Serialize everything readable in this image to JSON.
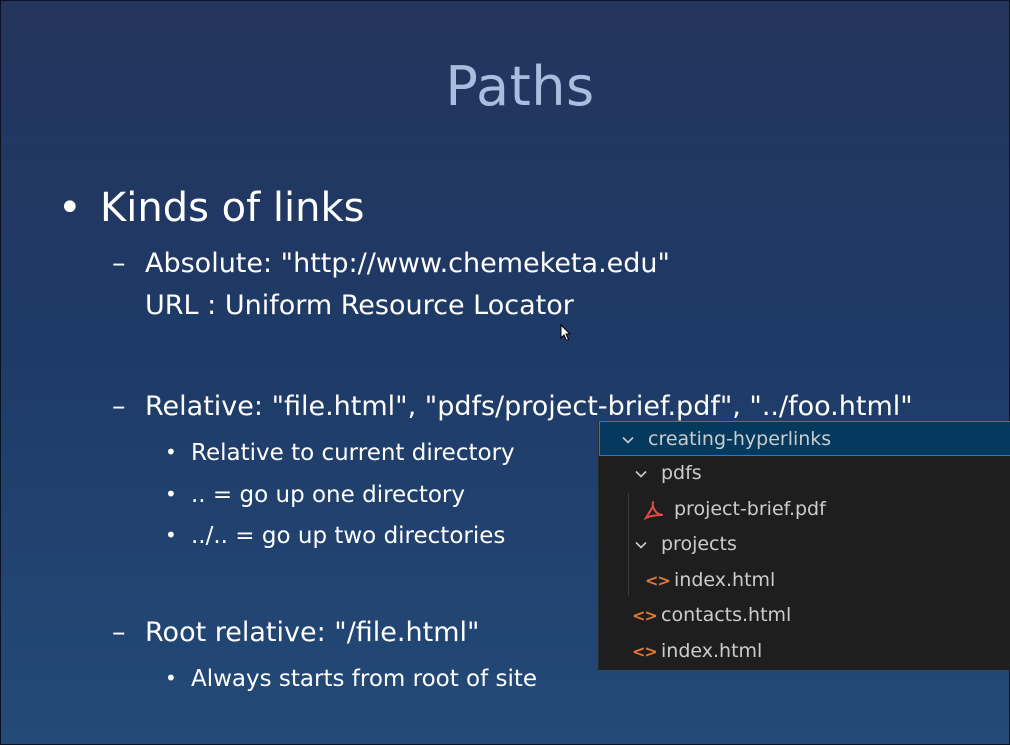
{
  "slide": {
    "title": "Paths",
    "main_bullet": "Kinds of links",
    "absolute": {
      "line1": "Absolute: \"http://www.chemeketa.edu\"",
      "line2": "URL : Uniform Resource Locator"
    },
    "relative": {
      "line": "Relative: \"file.html\", \"pdfs/project-brief.pdf\", \"../foo.html\"",
      "sub": [
        "Relative to current directory",
        ".. = go up one directory",
        "../.. = go up two directories"
      ]
    },
    "root_relative": {
      "line": "Root relative: \"/file.html\"",
      "sub": [
        "Always starts from root of site"
      ]
    },
    "bullet_glyph": "•",
    "dash_glyph": "–"
  },
  "explorer": {
    "root": "creating-hyperlinks",
    "items": [
      {
        "label": "pdfs",
        "type": "folder",
        "icon": "chevron-down-icon"
      },
      {
        "label": "project-brief.pdf",
        "type": "file",
        "icon": "pdf-icon"
      },
      {
        "label": "projects",
        "type": "folder",
        "icon": "chevron-down-icon"
      },
      {
        "label": "index.html",
        "type": "file",
        "icon": "html-code-icon"
      },
      {
        "label": "contacts.html",
        "type": "file",
        "icon": "html-code-icon"
      },
      {
        "label": "index.html",
        "type": "file",
        "icon": "html-code-icon"
      }
    ],
    "html_icon_glyph": "<>",
    "colors": {
      "background": "#1e1e1e",
      "selected": "#05395e",
      "selected_border": "#1a7fd6",
      "html_icon": "#e37933",
      "pdf_icon": "#e04b45"
    }
  }
}
